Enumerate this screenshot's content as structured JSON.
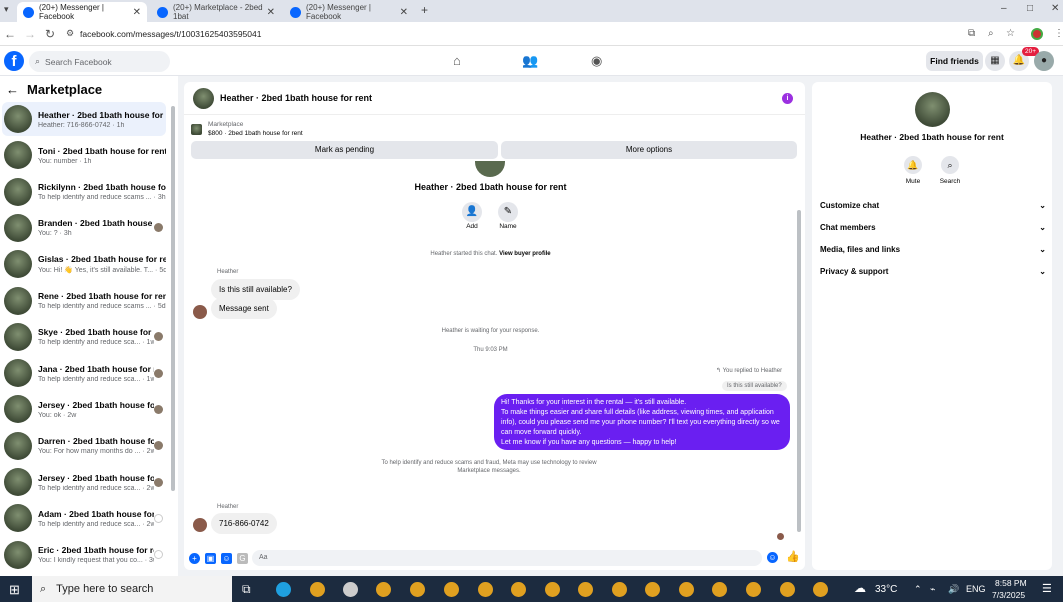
{
  "browser": {
    "tabs": [
      {
        "title": "(20+) Messenger | Facebook",
        "active": true
      },
      {
        "title": "(20+) Marketplace - 2bed 1bat",
        "active": false
      },
      {
        "title": "(20+) Messenger | Facebook",
        "active": false
      }
    ],
    "url": "facebook.com/messages/t/10031625403595041"
  },
  "fb": {
    "search_placeholder": "Search Facebook",
    "find_friends": "Find friends",
    "notif_badge": "20+"
  },
  "sidebar": {
    "title": "Marketplace",
    "conversations": [
      {
        "title": "Heather · 2bed 1bath house for ...",
        "preview": "Heather: 716-866-0742 · 1h",
        "active": true
      },
      {
        "title": "Toni · 2bed 1bath house for rent",
        "preview": "You: number · 1h"
      },
      {
        "title": "Rickilynn · 2bed 1bath house for...",
        "preview": "To help identify and reduce scams ... · 3h"
      },
      {
        "title": "Branden · 2bed 1bath house f...",
        "preview": "You: ? · 3h"
      },
      {
        "title": "Gislas · 2bed 1bath house for rent",
        "preview": "You: Hi! 👋 Yes, it's still available. T... · 5d"
      },
      {
        "title": "Rene · 2bed 1bath house for rent",
        "preview": "To help identify and reduce scams ... · 5d"
      },
      {
        "title": "Skye · 2bed 1bath house for r...",
        "preview": "To help identify and reduce sca... · 1w"
      },
      {
        "title": "Jana · 2bed 1bath house for r...",
        "preview": "To help identify and reduce sca... · 1w"
      },
      {
        "title": "Jersey · 2bed 1bath house for ...",
        "preview": "You: ok · 2w"
      },
      {
        "title": "Darren · 2bed 1bath house for...",
        "preview": "You: For how many months do ... · 2w"
      },
      {
        "title": "Jersey · 2bed 1bath house for ...",
        "preview": "To help identify and reduce sca... · 2w"
      },
      {
        "title": "Adam · 2bed 1bath house for ...",
        "preview": "To help identify and reduce sca... · 2w"
      },
      {
        "title": "Eric · 2bed 1bath house for rent",
        "preview": "You: I kindly request that you co... · 3w"
      }
    ]
  },
  "chat": {
    "header_name": "Heather · 2bed 1bath house for rent",
    "marketplace_label": "Marketplace",
    "listing": "$800 · 2bed 1bath house for rent",
    "mark_pending": "Mark as pending",
    "more_options": "More options",
    "profile_name": "Heather · 2bed 1bath house for rent",
    "add_label": "Add",
    "name_label": "Name",
    "started_text": "Heather started this chat. ",
    "view_buyer": "View buyer profile",
    "sender1": "Heather",
    "msg1": "Is this still available?",
    "msg2": "Message sent",
    "waiting": "Heather is waiting for your response.",
    "time": "Thu 9:03 PM",
    "replied_to": "You replied to Heather",
    "quote": "Is this still available?",
    "outgoing": "Hi! Thanks for your interest in the rental — it's still available.\nTo make things easier and share full details (like address, viewing times, and application info), could you please send me your phone number? I'll text you everything directly so we can move forward quickly.\nLet me know if you have any questions — happy to help!",
    "notice": "To help identify and reduce scams and fraud, Meta may use technology to review Marketplace messages.",
    "sender2": "Heather",
    "msg3": "716-866-0742",
    "composer_placeholder": "Aa"
  },
  "right": {
    "name": "Heather · 2bed 1bath house for rent",
    "mute": "Mute",
    "search": "Search",
    "rows": [
      "Customize chat",
      "Chat members",
      "Media, files and links",
      "Privacy & support"
    ]
  },
  "taskbar": {
    "search": "Type here to search",
    "temp": "33°C",
    "lang": "ENG",
    "time": "8:58 PM",
    "date": "7/3/2025"
  }
}
